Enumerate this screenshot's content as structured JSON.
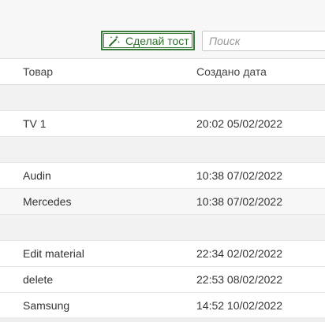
{
  "toolbar": {
    "toast_button_label": "Сделай тост",
    "toast_button_icon": "magic-wand-icon",
    "search_placeholder": "Поиск",
    "search_value": "",
    "accent_color": "#2f6f2f"
  },
  "table": {
    "columns": [
      "Товар",
      "Создано дата"
    ],
    "rows": [
      {
        "type": "group",
        "product": "",
        "created": ""
      },
      {
        "type": "data",
        "product": "TV 1",
        "created": "20:02 05/02/2022"
      },
      {
        "type": "group",
        "product": "",
        "created": ""
      },
      {
        "type": "data",
        "product": "Audin",
        "created": "10:38 07/02/2022"
      },
      {
        "type": "data",
        "product": "Mercedes",
        "created": "10:38 07/02/2022"
      },
      {
        "type": "group",
        "product": "",
        "created": ""
      },
      {
        "type": "data",
        "product": "Edit material",
        "created": "22:34 02/02/2022"
      },
      {
        "type": "data",
        "product": "delete",
        "created": "22:53 08/02/2022"
      },
      {
        "type": "data",
        "product": "Samsung",
        "created": "14:52 10/02/2022"
      }
    ]
  }
}
